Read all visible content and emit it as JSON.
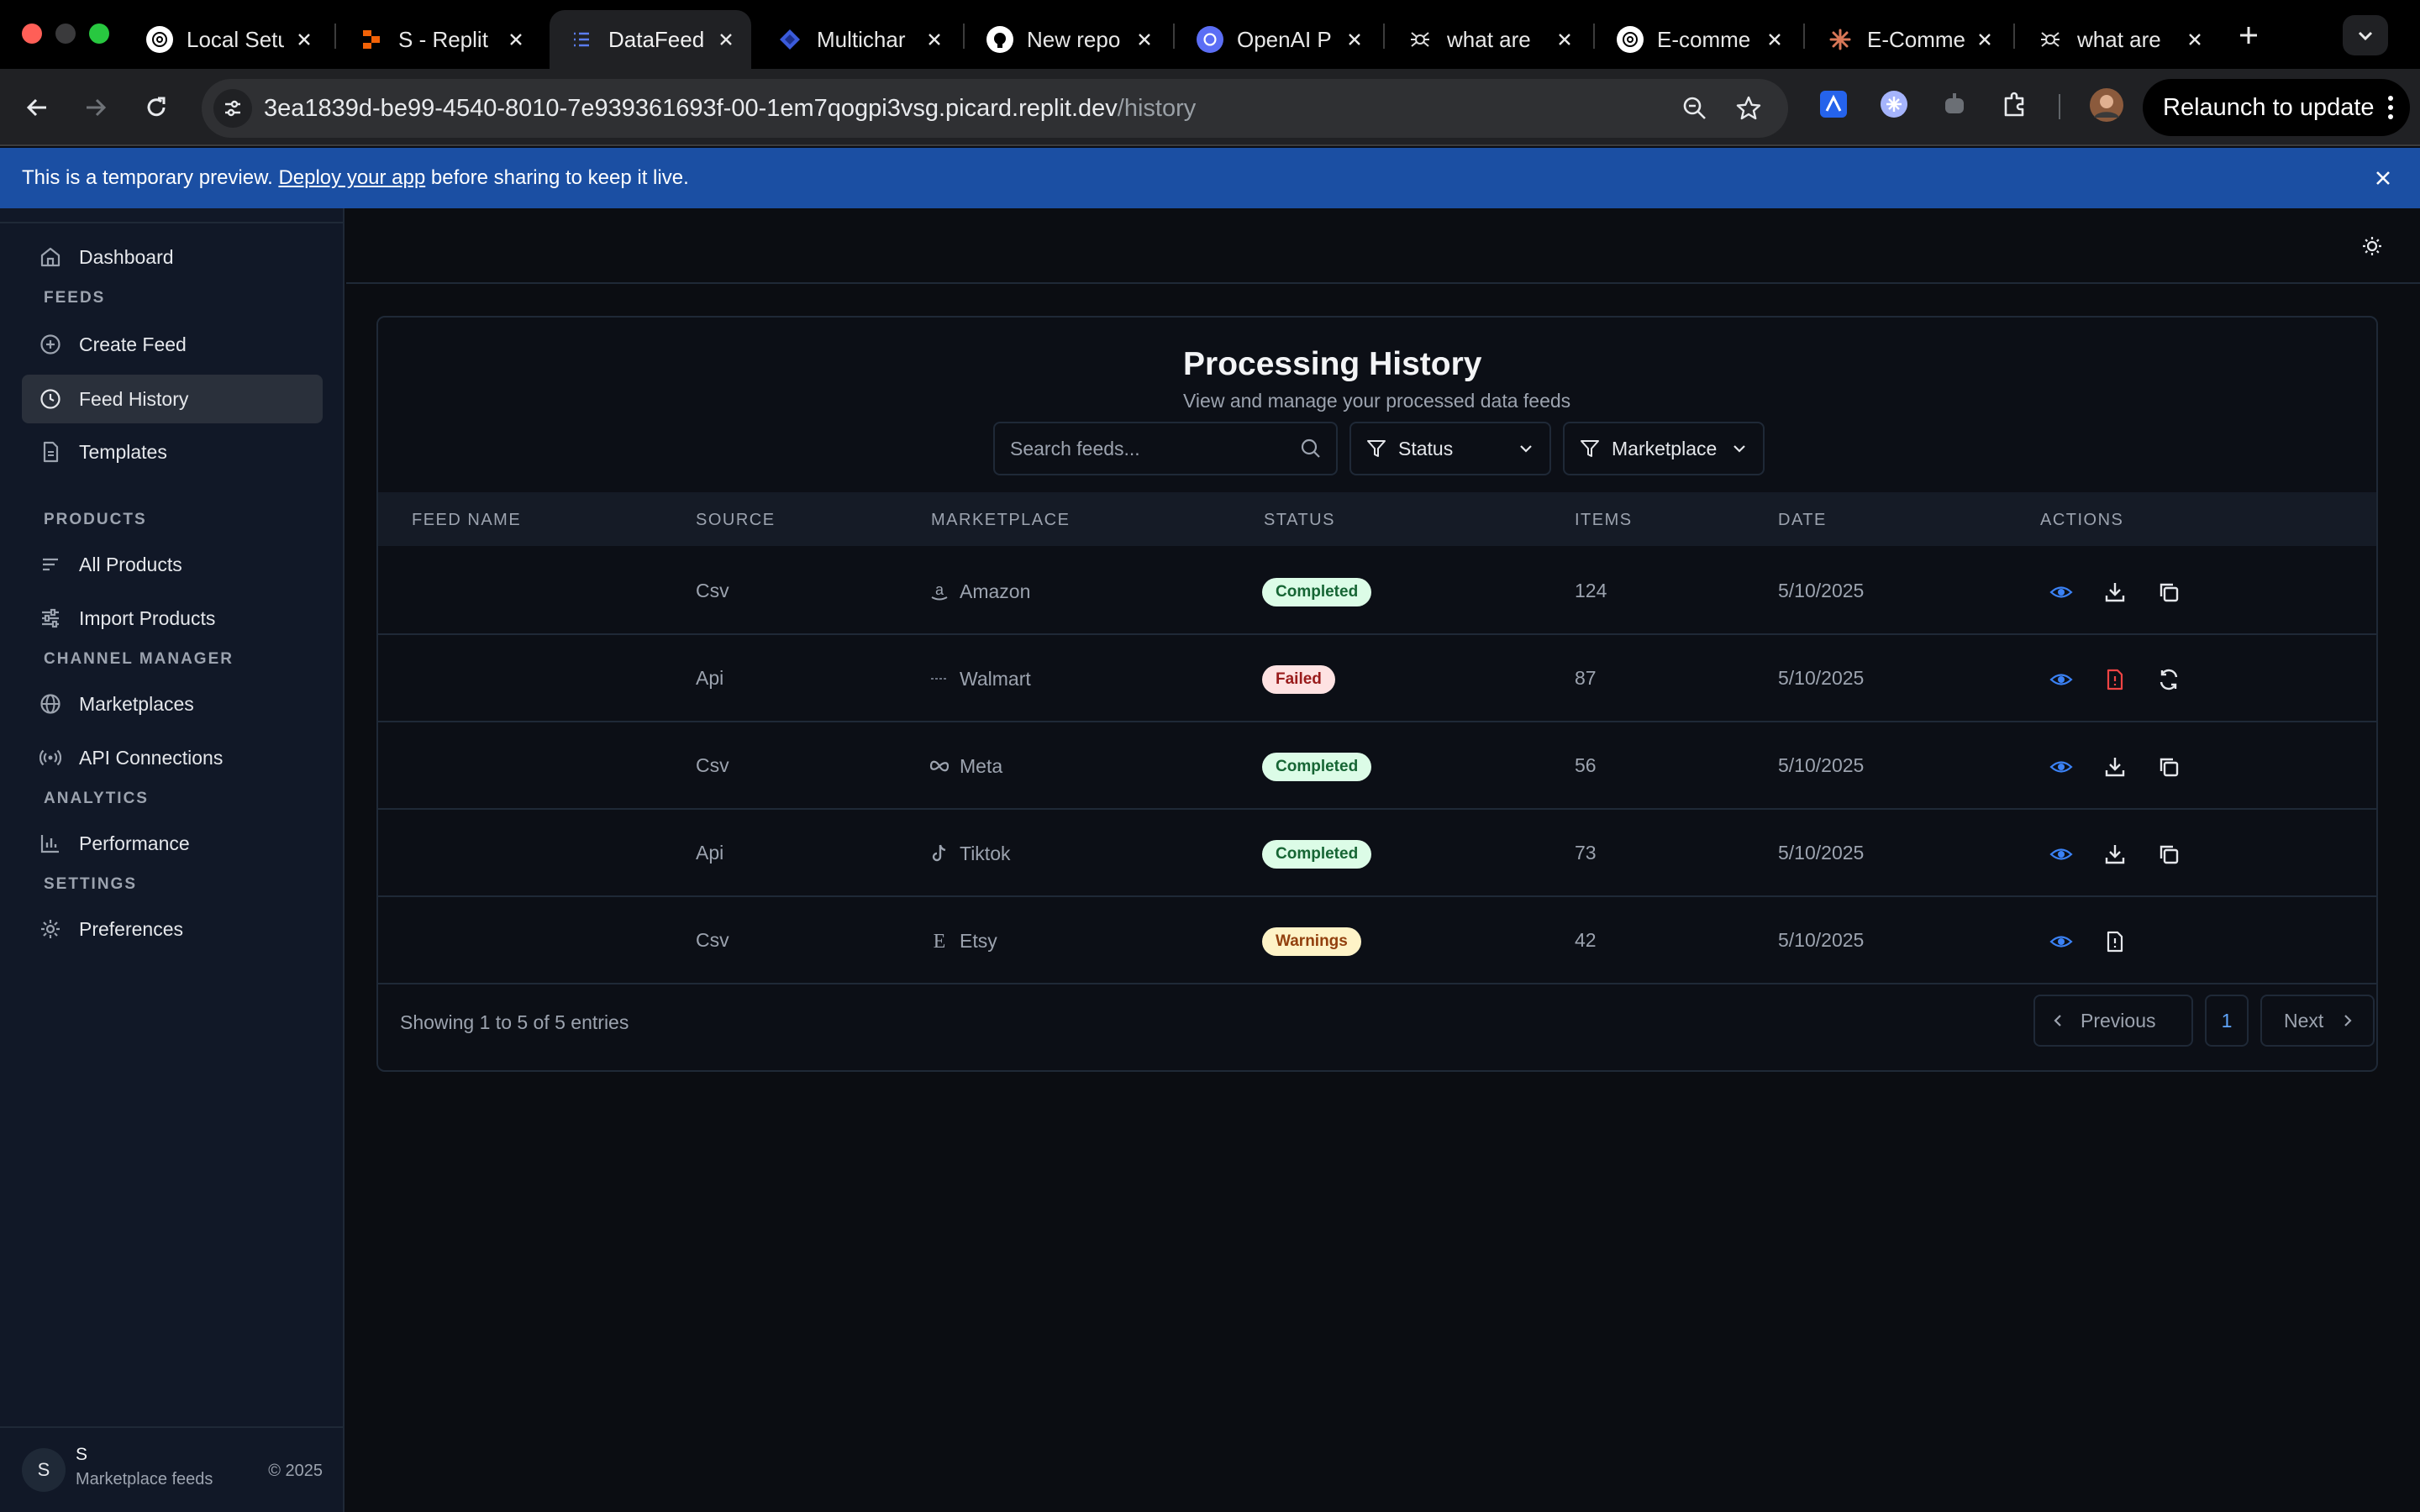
{
  "browser": {
    "tabs": [
      {
        "title": "Local Setu",
        "icon": "openai-icon",
        "active": false
      },
      {
        "title": "S - Replit",
        "icon": "replit-icon",
        "active": false
      },
      {
        "title": "DataFeed",
        "icon": "list-icon",
        "active": true
      },
      {
        "title": "Multichar",
        "icon": "diamond-icon",
        "active": false
      },
      {
        "title": "New repo",
        "icon": "github-icon",
        "active": false
      },
      {
        "title": "OpenAI P",
        "icon": "openai-icon",
        "active": false
      },
      {
        "title": "what are",
        "icon": "spider-icon",
        "active": false
      },
      {
        "title": "E-comme",
        "icon": "openai-icon",
        "active": false
      },
      {
        "title": "E-Comme",
        "icon": "claude-icon",
        "active": false
      },
      {
        "title": "what are",
        "icon": "spider-icon",
        "active": false
      }
    ],
    "url_host": "3ea1839d-be99-4540-8010-7e939361693f-00-1em7qogpi3vsg.picard.replit.dev",
    "url_path": "/history",
    "relaunch_label": "Relaunch to update"
  },
  "banner": {
    "prefix": "This is a temporary preview. ",
    "link": "Deploy your app",
    "suffix": " before sharing to keep it live."
  },
  "sidebar": {
    "dashboard": "Dashboard",
    "feeds_section": "FEEDS",
    "create_feed": "Create Feed",
    "feed_history": "Feed History",
    "templates": "Templates",
    "products_section": "PRODUCTS",
    "all_products": "All Products",
    "import_products": "Import Products",
    "channel_section": "CHANNEL MANAGER",
    "marketplaces": "Marketplaces",
    "api_connections": "API Connections",
    "analytics_section": "ANALYTICS",
    "performance": "Performance",
    "settings_section": "SETTINGS",
    "preferences": "Preferences",
    "footer": {
      "avatar": "S",
      "user": "S",
      "subtitle": "Marketplace feeds",
      "copyright": "© 2025"
    }
  },
  "main": {
    "title": "Processing History",
    "subtitle": "View and manage your processed data feeds",
    "search_placeholder": "Search feeds...",
    "status_filter": "Status",
    "marketplace_filter": "Marketplace",
    "columns": [
      "FEED NAME",
      "SOURCE",
      "MARKETPLACE",
      "STATUS",
      "ITEMS",
      "DATE",
      "ACTIONS"
    ],
    "rows": [
      {
        "name": "",
        "source": "Csv",
        "marketplace": "Amazon",
        "status": "Completed",
        "items": "124",
        "date": "5/10/2025"
      },
      {
        "name": "",
        "source": "Api",
        "marketplace": "Walmart",
        "status": "Failed",
        "items": "87",
        "date": "5/10/2025"
      },
      {
        "name": "",
        "source": "Csv",
        "marketplace": "Meta",
        "status": "Completed",
        "items": "56",
        "date": "5/10/2025"
      },
      {
        "name": "",
        "source": "Api",
        "marketplace": "Tiktok",
        "status": "Completed",
        "items": "73",
        "date": "5/10/2025"
      },
      {
        "name": "",
        "source": "Csv",
        "marketplace": "Etsy",
        "status": "Warnings",
        "items": "42",
        "date": "5/10/2025"
      }
    ],
    "showing": "Showing 1 to 5 of 5 entries",
    "pagination": {
      "previous": "Previous",
      "page": "1",
      "next": "Next"
    }
  },
  "colors": {
    "accent": "#3b82f6",
    "banner": "#1b4fa3",
    "completed_bg": "#dcfce7",
    "failed_bg": "#fee2e2",
    "warnings_bg": "#fef3c7"
  }
}
